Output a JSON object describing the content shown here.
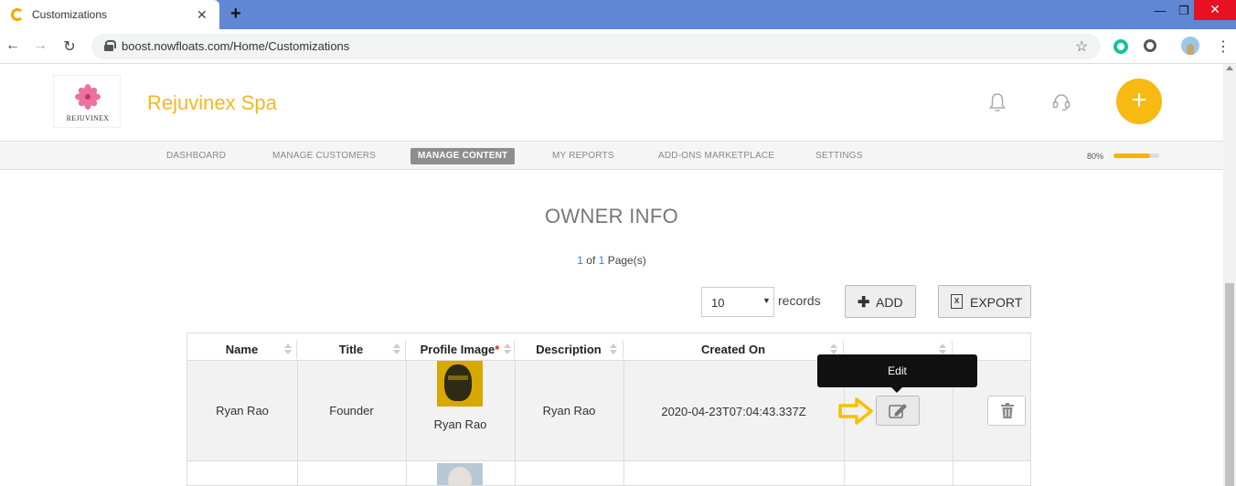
{
  "browser": {
    "tab_title": "Customizations",
    "tab_close": "✕",
    "new_tab": "+",
    "url": "boost.nowfloats.com/Home/Customizations",
    "window_controls": {
      "minimize": "—",
      "restore": "❐",
      "close": "✕"
    }
  },
  "header": {
    "logo_text": "REJUVINEX",
    "brand_name": "Rejuvinex Spa",
    "fab_label": "+"
  },
  "nav": {
    "items": [
      "DASHBOARD",
      "MANAGE CUSTOMERS",
      "MANAGE CONTENT",
      "MY REPORTS",
      "ADD-ONS MARKETPLACE",
      "SETTINGS"
    ],
    "active": "MANAGE CONTENT",
    "progress_label": "80%",
    "progress_value": 0.8
  },
  "section": {
    "title": "OWNER INFO",
    "pager": {
      "current": "1",
      "of": "of",
      "total": "1",
      "suffix": "Page(s)"
    }
  },
  "toolbar": {
    "records_value": "10",
    "records_label": "records",
    "add_label": "ADD",
    "export_label": "EXPORT",
    "export_glyph": "X"
  },
  "table": {
    "columns": [
      "Name",
      "Title",
      "Profile Image",
      "Description",
      "Created On",
      ""
    ],
    "required_marker": "*",
    "rows": [
      {
        "name": "Ryan Rao",
        "title": "Founder",
        "image_caption": "Ryan Rao",
        "description": "Ryan Rao",
        "created_on": "2020-04-23T07:04:43.337Z"
      }
    ]
  },
  "tooltip": {
    "text": "Edit"
  },
  "colors": {
    "accent": "#f6b81e",
    "chrome_tab_bar": "#5f87d3",
    "tooltip_bg": "#111111"
  }
}
